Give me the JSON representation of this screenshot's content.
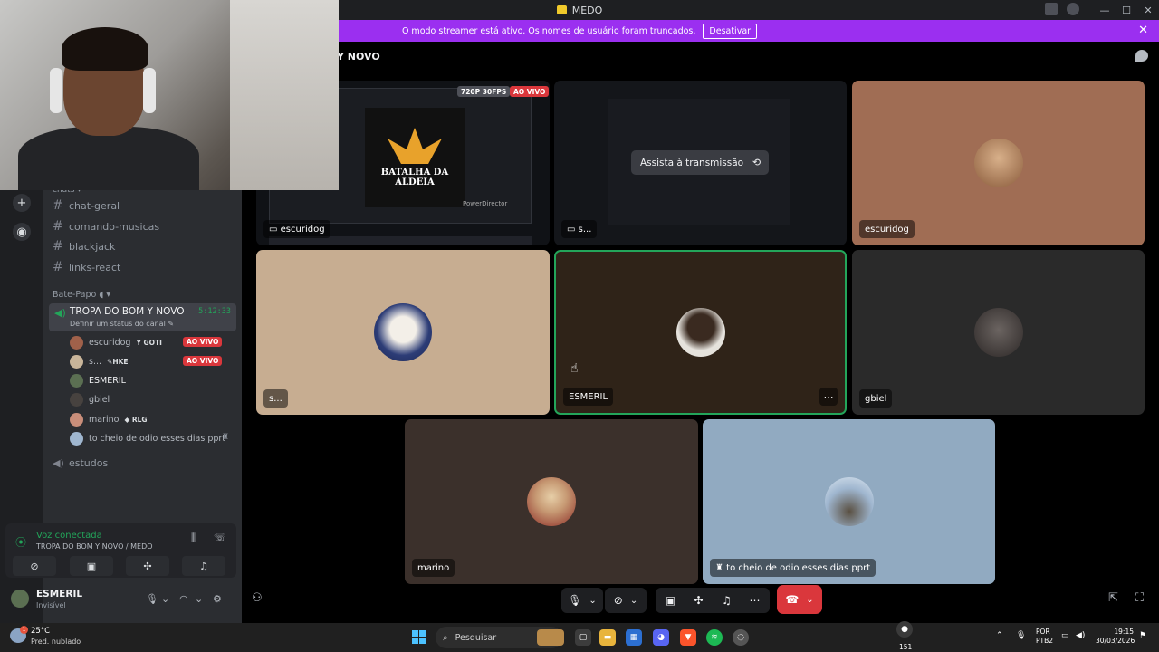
{
  "window": {
    "title": "MEDO",
    "controls": [
      "—",
      "☐",
      "✕"
    ]
  },
  "banner": {
    "text": "O modo streamer está ativo. Os nomes de usuário foram truncados.",
    "button": "Desativar",
    "close": "✕"
  },
  "rail": {
    "add_icon": "+",
    "explore_icon": "◉"
  },
  "sidebar": {
    "category_partial": "chats ▾",
    "channels": [
      {
        "name": "chat-geral"
      },
      {
        "name": "comando-musicas"
      },
      {
        "name": "blackjack"
      },
      {
        "name": "links-react"
      }
    ],
    "voice_category": "Bate-Papo",
    "active_voice": {
      "name": "TROPA DO BOM Y NOVO",
      "status": "Definir um status do canal ✎",
      "timer": "5:12:33"
    },
    "voice_users": [
      {
        "name": "escuridog",
        "tag": "GOTI",
        "tag_prefix": "Y",
        "live": "AO VIVO"
      },
      {
        "name": "s...",
        "tag": "HKE",
        "tag_prefix": "✎",
        "live": "AO VIVO"
      },
      {
        "name": "ESMERIL",
        "tag": "",
        "live": ""
      },
      {
        "name": "gbiel",
        "tag": "",
        "live": ""
      },
      {
        "name": "marino",
        "tag": "RLG",
        "tag_prefix": "◆",
        "live": ""
      },
      {
        "name": "to cheio de odio esses dias pprt",
        "tag": "",
        "live": ""
      }
    ],
    "other_voice": "estudos",
    "voice_panel": {
      "title": "Voz conectada",
      "subtitle": "TROPA DO BOM Y NOVO / MEDO"
    },
    "user": {
      "name": "ESMERIL",
      "status": "Invisível"
    }
  },
  "main": {
    "channel_title": "Y NOVO",
    "tiles": {
      "stream1": {
        "label": "escuridog",
        "quality": "720P 30FPS",
        "live": "AO VIVO",
        "logo_text": "BATALHA DA ALDEIA",
        "caption": "PowerDirector"
      },
      "stream2": {
        "label": "s...",
        "watch": "Assista à transmissão"
      },
      "escuridog": {
        "label": "escuridog"
      },
      "s": {
        "label": "s..."
      },
      "esmeril": {
        "label": "ESMERIL",
        "more": "⋯"
      },
      "gbiel": {
        "label": "gbiel"
      },
      "marino": {
        "label": "marino"
      },
      "odio": {
        "label": "to cheio de odio esses dias pprt"
      }
    }
  },
  "taskbar": {
    "temp": "25°C",
    "condition": "Pred. nublado",
    "search": "Pesquisar",
    "lang1": "POR",
    "lang2": "PTB2",
    "time": "19:15",
    "date": "30/03/2026",
    "count": "151"
  },
  "colors": {
    "banner": "#9b2ff0",
    "live": "#da373c",
    "connected": "#23a55a",
    "hangup": "#da373c"
  }
}
